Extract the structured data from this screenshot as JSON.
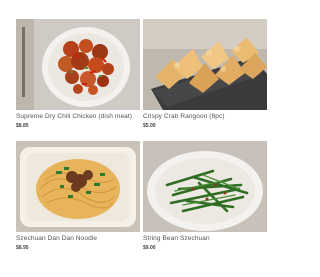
{
  "menu": {
    "items": [
      {
        "name": "Supreme Dry Chili Chicken (dish meat)",
        "price": "$8.85"
      },
      {
        "name": "Crispy Crab Rangoon (8pc)",
        "price": "$5.00"
      },
      {
        "name": "Szechuan Dan Dan Noodle",
        "price": "$8.95"
      },
      {
        "name": "String Bean Szechuan",
        "price": "$9.00"
      }
    ]
  }
}
